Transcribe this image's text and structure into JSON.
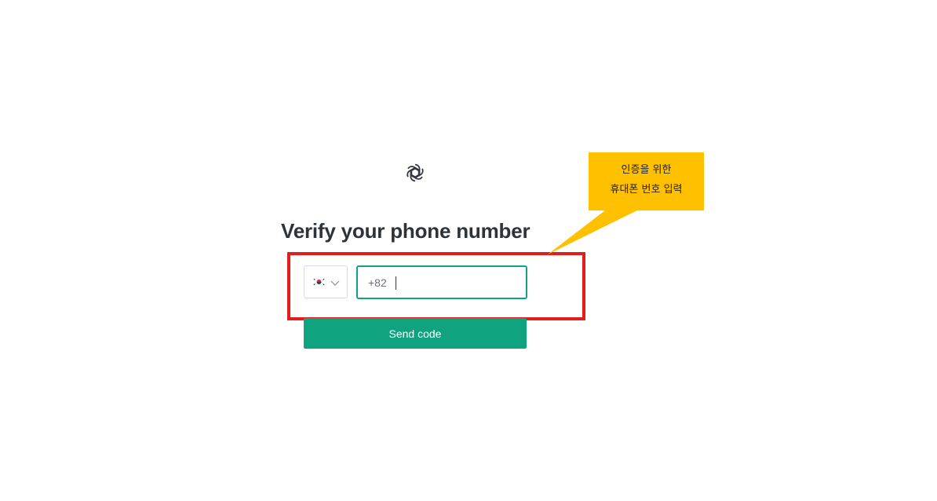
{
  "colors": {
    "accent": "#10a37f",
    "highlight_border": "#e51c1c",
    "callout_fill": "#ffc000",
    "title_text": "#2d333a"
  },
  "logo": {
    "icon": "openai-logo-icon"
  },
  "title": "Verify your phone number",
  "phone": {
    "country_flag": "south-korea-flag-icon",
    "dropdown_icon": "chevron-down-icon",
    "value": "+82 "
  },
  "send_button_label": "Send code",
  "annotation": {
    "line1": "인증을 위한",
    "line2": "휴대폰 번호 입력"
  }
}
